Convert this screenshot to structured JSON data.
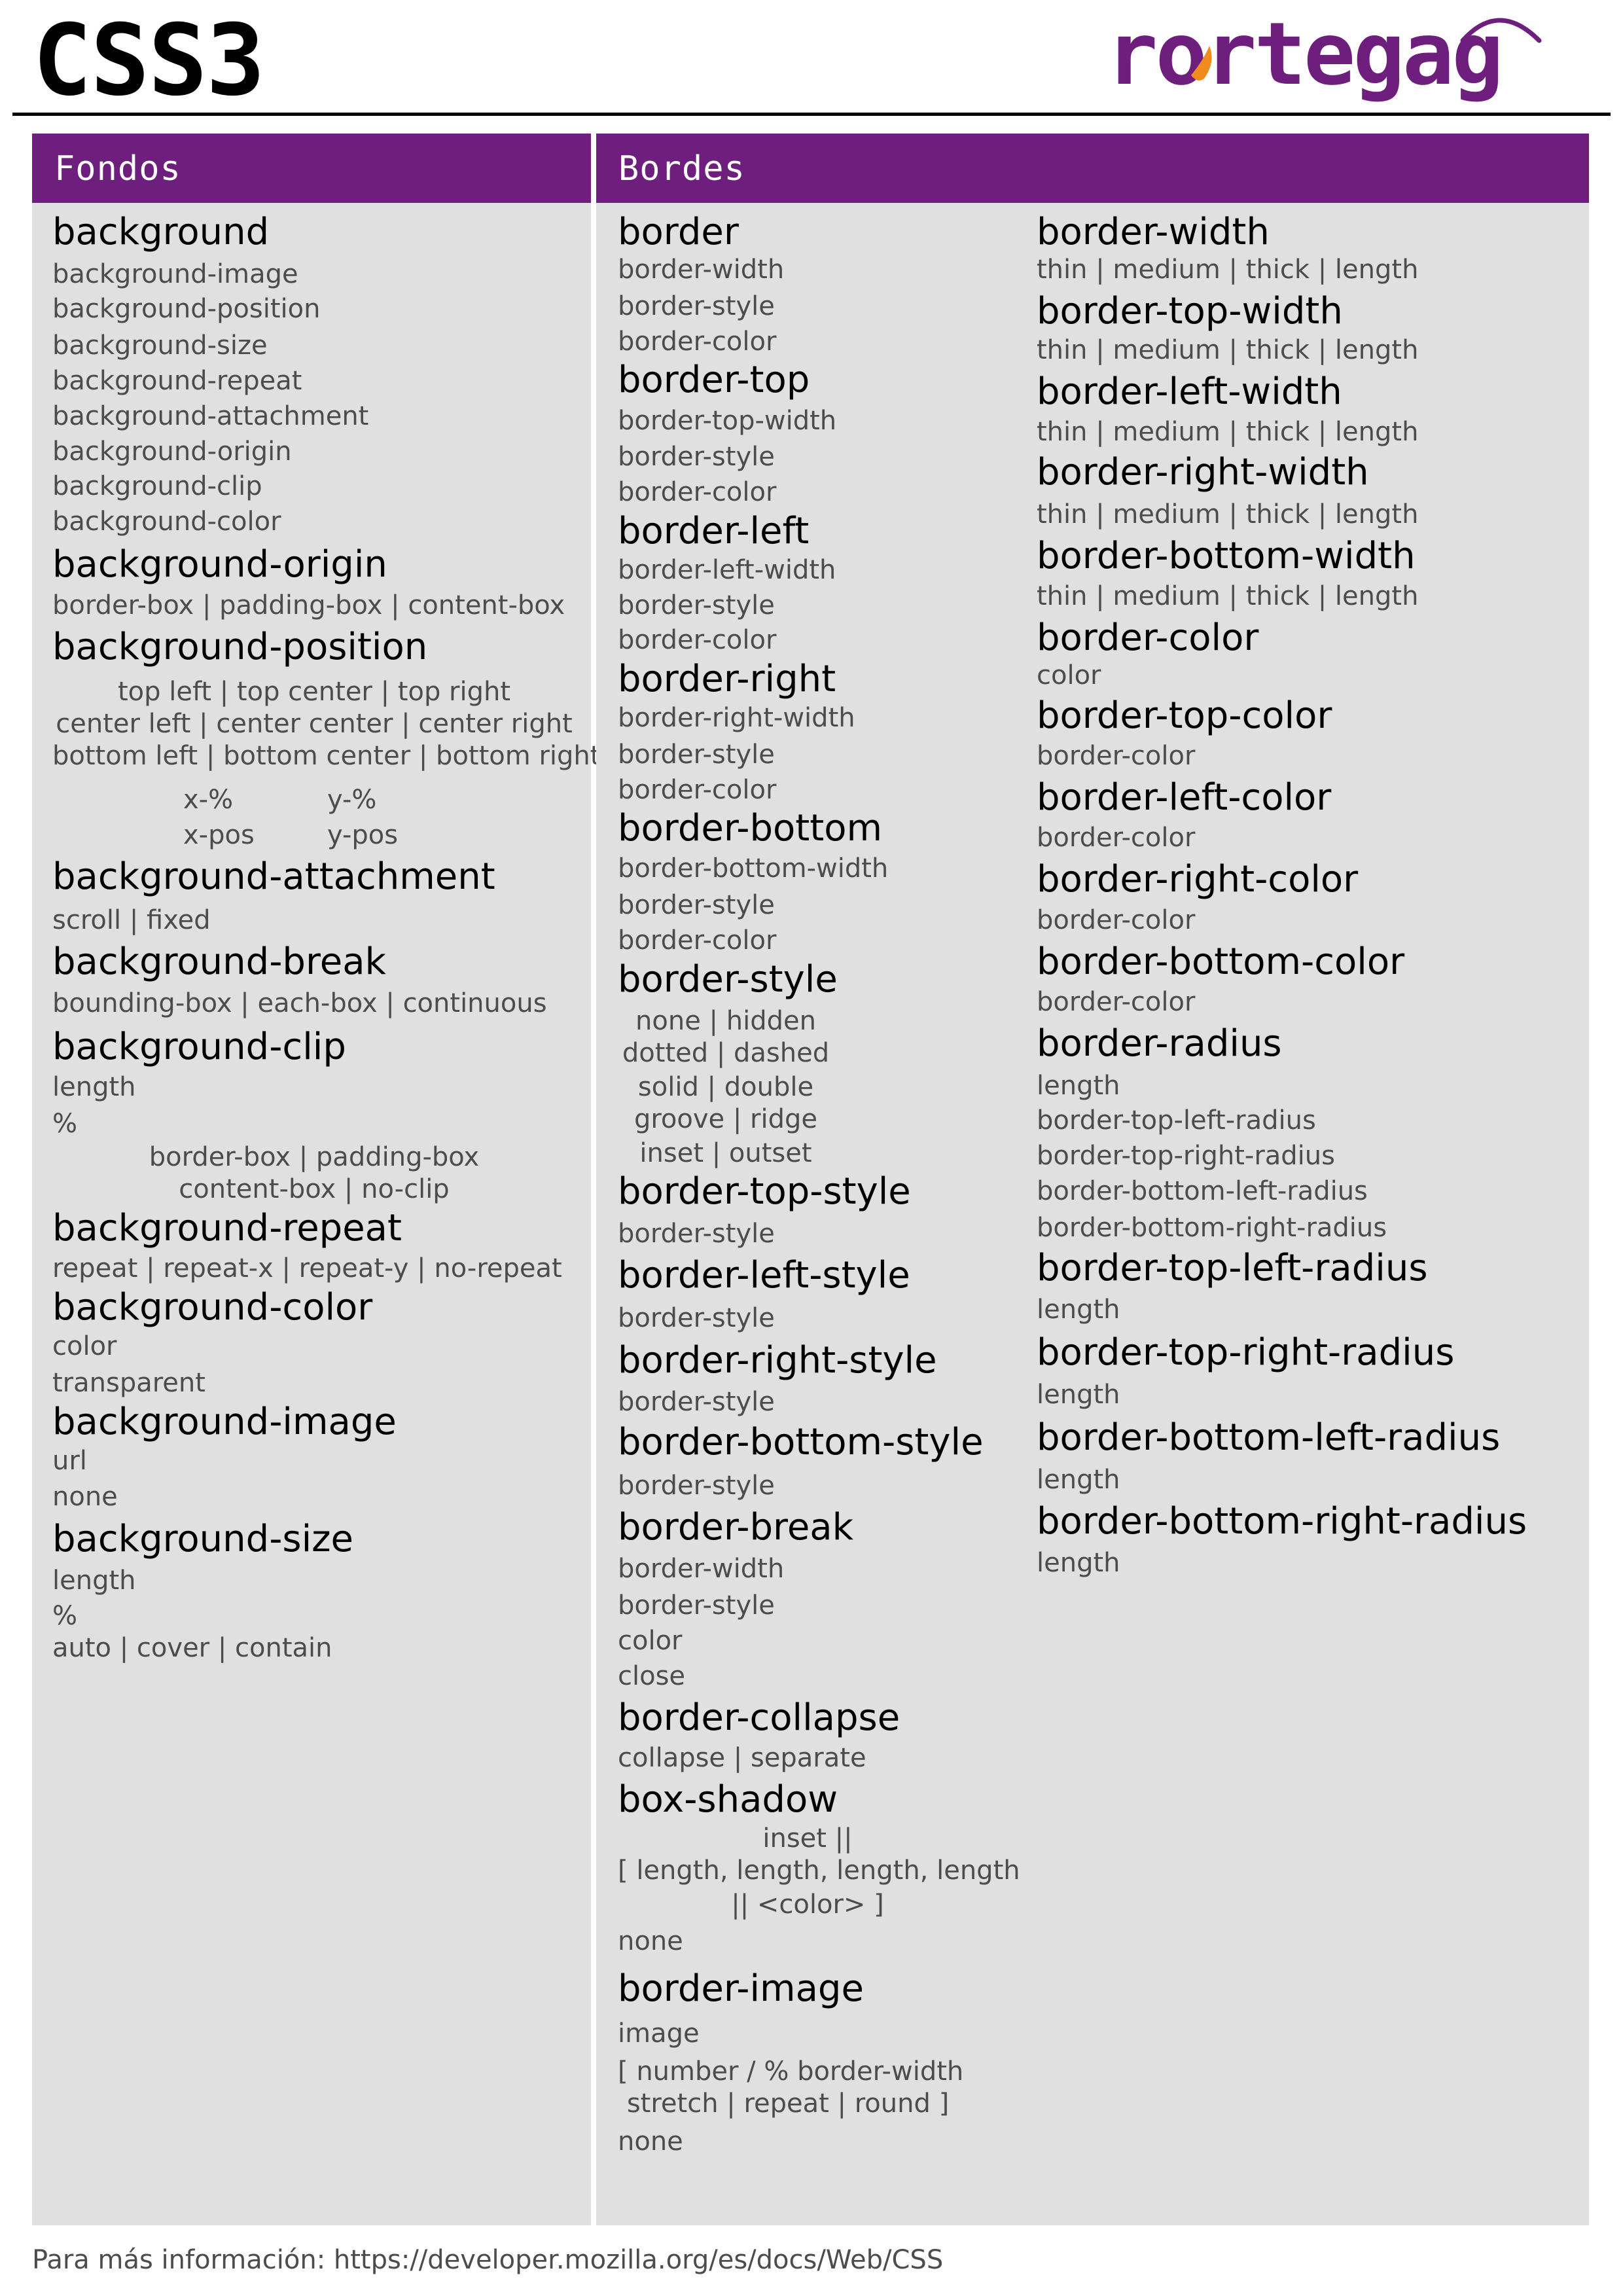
{
  "header": {
    "title": "CSS3",
    "logo_text": "rortegag",
    "logo_colors": {
      "primary": "#6e1e7c",
      "accent": "#f08c1e"
    }
  },
  "theme": {
    "panel_header": "#6e1e7c",
    "panel_bg": "#e0e0e0",
    "heading": "#000000",
    "value": "#4d4b4b"
  },
  "sections": {
    "fondos": {
      "title": "Fondos",
      "lines": [
        {
          "t": "h",
          "text": "background"
        },
        {
          "t": "s",
          "text": "background-image"
        },
        {
          "t": "s",
          "text": "background-position"
        },
        {
          "t": "s",
          "text": "background-size"
        },
        {
          "t": "s",
          "text": "background-repeat"
        },
        {
          "t": "s",
          "text": "background-attachment"
        },
        {
          "t": "s",
          "text": "background-origin"
        },
        {
          "t": "s",
          "text": "background-clip"
        },
        {
          "t": "s",
          "text": "background-color"
        },
        {
          "t": "h",
          "text": "background-origin"
        },
        {
          "t": "s",
          "text": "border-box | padding-box | content-box"
        },
        {
          "t": "h",
          "text": "background-position"
        },
        {
          "t": "s",
          "text": "top left | top center | top right",
          "align": "center"
        },
        {
          "t": "s",
          "text": "center left | center center | center right",
          "align": "center"
        },
        {
          "t": "s",
          "text": "bottom left | bottom center | bottom right",
          "align": "center"
        },
        {
          "t": "s",
          "text": "x-%",
          "align": "x1"
        },
        {
          "t": "s",
          "text": "y-%",
          "align": "x2"
        },
        {
          "t": "s",
          "text": "x-pos",
          "align": "x1"
        },
        {
          "t": "s",
          "text": "y-pos",
          "align": "x2"
        },
        {
          "t": "h",
          "text": "background-attachment"
        },
        {
          "t": "s",
          "text": "scroll | fixed"
        },
        {
          "t": "h",
          "text": "background-break"
        },
        {
          "t": "s",
          "text": "bounding-box | each-box | continuous"
        },
        {
          "t": "h",
          "text": "background-clip"
        },
        {
          "t": "s",
          "text": "length"
        },
        {
          "t": "s",
          "text": "%"
        },
        {
          "t": "s",
          "text": "border-box | padding-box",
          "align": "center"
        },
        {
          "t": "s",
          "text": "content-box | no-clip",
          "align": "center"
        },
        {
          "t": "h",
          "text": "background-repeat"
        },
        {
          "t": "s",
          "text": "repeat | repeat-x | repeat-y | no-repeat"
        },
        {
          "t": "h",
          "text": "background-color"
        },
        {
          "t": "s",
          "text": "color"
        },
        {
          "t": "s",
          "text": "transparent"
        },
        {
          "t": "h",
          "text": "background-image"
        },
        {
          "t": "s",
          "text": "url"
        },
        {
          "t": "s",
          "text": "none"
        },
        {
          "t": "h",
          "text": "background-size"
        },
        {
          "t": "s",
          "text": "length"
        },
        {
          "t": "s",
          "text": "%"
        },
        {
          "t": "s",
          "text": "auto | cover | contain"
        }
      ]
    },
    "bordes": {
      "title": "Bordes",
      "col1": [
        {
          "t": "h",
          "text": "border"
        },
        {
          "t": "s",
          "text": "border-width"
        },
        {
          "t": "s",
          "text": "border-style"
        },
        {
          "t": "s",
          "text": "border-color"
        },
        {
          "t": "h",
          "text": "border-top"
        },
        {
          "t": "s",
          "text": "border-top-width"
        },
        {
          "t": "s",
          "text": "border-style"
        },
        {
          "t": "s",
          "text": "border-color"
        },
        {
          "t": "h",
          "text": "border-left"
        },
        {
          "t": "s",
          "text": "border-left-width"
        },
        {
          "t": "s",
          "text": "border-style"
        },
        {
          "t": "s",
          "text": "border-color"
        },
        {
          "t": "h",
          "text": "border-right"
        },
        {
          "t": "s",
          "text": "border-right-width"
        },
        {
          "t": "s",
          "text": "border-style"
        },
        {
          "t": "s",
          "text": "border-color"
        },
        {
          "t": "h",
          "text": "border-bottom"
        },
        {
          "t": "s",
          "text": "border-bottom-width"
        },
        {
          "t": "s",
          "text": "border-style"
        },
        {
          "t": "s",
          "text": "border-color"
        },
        {
          "t": "h",
          "text": "border-style"
        },
        {
          "t": "s",
          "text": "none | hidden",
          "align": "ctr"
        },
        {
          "t": "s",
          "text": "dotted | dashed",
          "align": "ctr"
        },
        {
          "t": "s",
          "text": "solid | double",
          "align": "ctr"
        },
        {
          "t": "s",
          "text": "groove | ridge",
          "align": "ctr"
        },
        {
          "t": "s",
          "text": "inset | outset",
          "align": "ctr"
        },
        {
          "t": "h",
          "text": "border-top-style"
        },
        {
          "t": "s",
          "text": "border-style"
        },
        {
          "t": "h",
          "text": "border-left-style"
        },
        {
          "t": "s",
          "text": "border-style"
        },
        {
          "t": "h",
          "text": "border-right-style"
        },
        {
          "t": "s",
          "text": "border-style"
        },
        {
          "t": "h",
          "text": "border-bottom-style"
        },
        {
          "t": "s",
          "text": "border-style"
        },
        {
          "t": "h",
          "text": "border-break"
        },
        {
          "t": "s",
          "text": "border-width"
        },
        {
          "t": "s",
          "text": "border-style"
        },
        {
          "t": "s",
          "text": "color"
        },
        {
          "t": "s",
          "text": "close"
        },
        {
          "t": "h",
          "text": "border-collapse"
        },
        {
          "t": "s",
          "text": "collapse | separate"
        },
        {
          "t": "h",
          "text": "box-shadow"
        },
        {
          "t": "s",
          "text": "inset ||",
          "align": "wide"
        },
        {
          "t": "s",
          "text": "[ length, length, length, length",
          "align": "wide"
        },
        {
          "t": "s",
          "text": "|| <color> ]",
          "align": "wide"
        },
        {
          "t": "s",
          "text": "none"
        },
        {
          "t": "h",
          "text": "border-image"
        },
        {
          "t": "s",
          "text": "image"
        },
        {
          "t": "s",
          "text": "[ number / % border-width",
          "align": "ctr2"
        },
        {
          "t": "s",
          "text": "stretch | repeat | round ]",
          "align": "ctr2"
        },
        {
          "t": "s",
          "text": "none"
        }
      ],
      "col2": [
        {
          "t": "h",
          "text": "border-width"
        },
        {
          "t": "s",
          "text": "thin | medium | thick | length"
        },
        {
          "t": "h",
          "text": "border-top-width"
        },
        {
          "t": "s",
          "text": "thin | medium | thick | length"
        },
        {
          "t": "h",
          "text": "border-left-width"
        },
        {
          "t": "s",
          "text": "thin | medium | thick | length"
        },
        {
          "t": "h",
          "text": "border-right-width"
        },
        {
          "t": "s",
          "text": "thin | medium | thick | length"
        },
        {
          "t": "h",
          "text": "border-bottom-width"
        },
        {
          "t": "s",
          "text": "thin | medium | thick | length"
        },
        {
          "t": "h",
          "text": "border-color"
        },
        {
          "t": "s",
          "text": "color"
        },
        {
          "t": "h",
          "text": "border-top-color"
        },
        {
          "t": "s",
          "text": "border-color"
        },
        {
          "t": "h",
          "text": "border-left-color"
        },
        {
          "t": "s",
          "text": "border-color"
        },
        {
          "t": "h",
          "text": "border-right-color"
        },
        {
          "t": "s",
          "text": "border-color"
        },
        {
          "t": "h",
          "text": "border-bottom-color"
        },
        {
          "t": "s",
          "text": "border-color"
        },
        {
          "t": "h",
          "text": "border-radius"
        },
        {
          "t": "s",
          "text": "length"
        },
        {
          "t": "s",
          "text": "border-top-left-radius"
        },
        {
          "t": "s",
          "text": "border-top-right-radius"
        },
        {
          "t": "s",
          "text": "border-bottom-left-radius"
        },
        {
          "t": "s",
          "text": "border-bottom-right-radius"
        },
        {
          "t": "h",
          "text": "border-top-left-radius"
        },
        {
          "t": "s",
          "text": "length"
        },
        {
          "t": "h",
          "text": "border-top-right-radius"
        },
        {
          "t": "s",
          "text": "length"
        },
        {
          "t": "h",
          "text": "border-bottom-left-radius"
        },
        {
          "t": "s",
          "text": "length"
        },
        {
          "t": "h",
          "text": "border-bottom-right-radius"
        },
        {
          "t": "s",
          "text": "length"
        }
      ]
    }
  },
  "footer": {
    "text": "Para más información: https://developer.mozilla.org/es/docs/Web/CSS"
  }
}
